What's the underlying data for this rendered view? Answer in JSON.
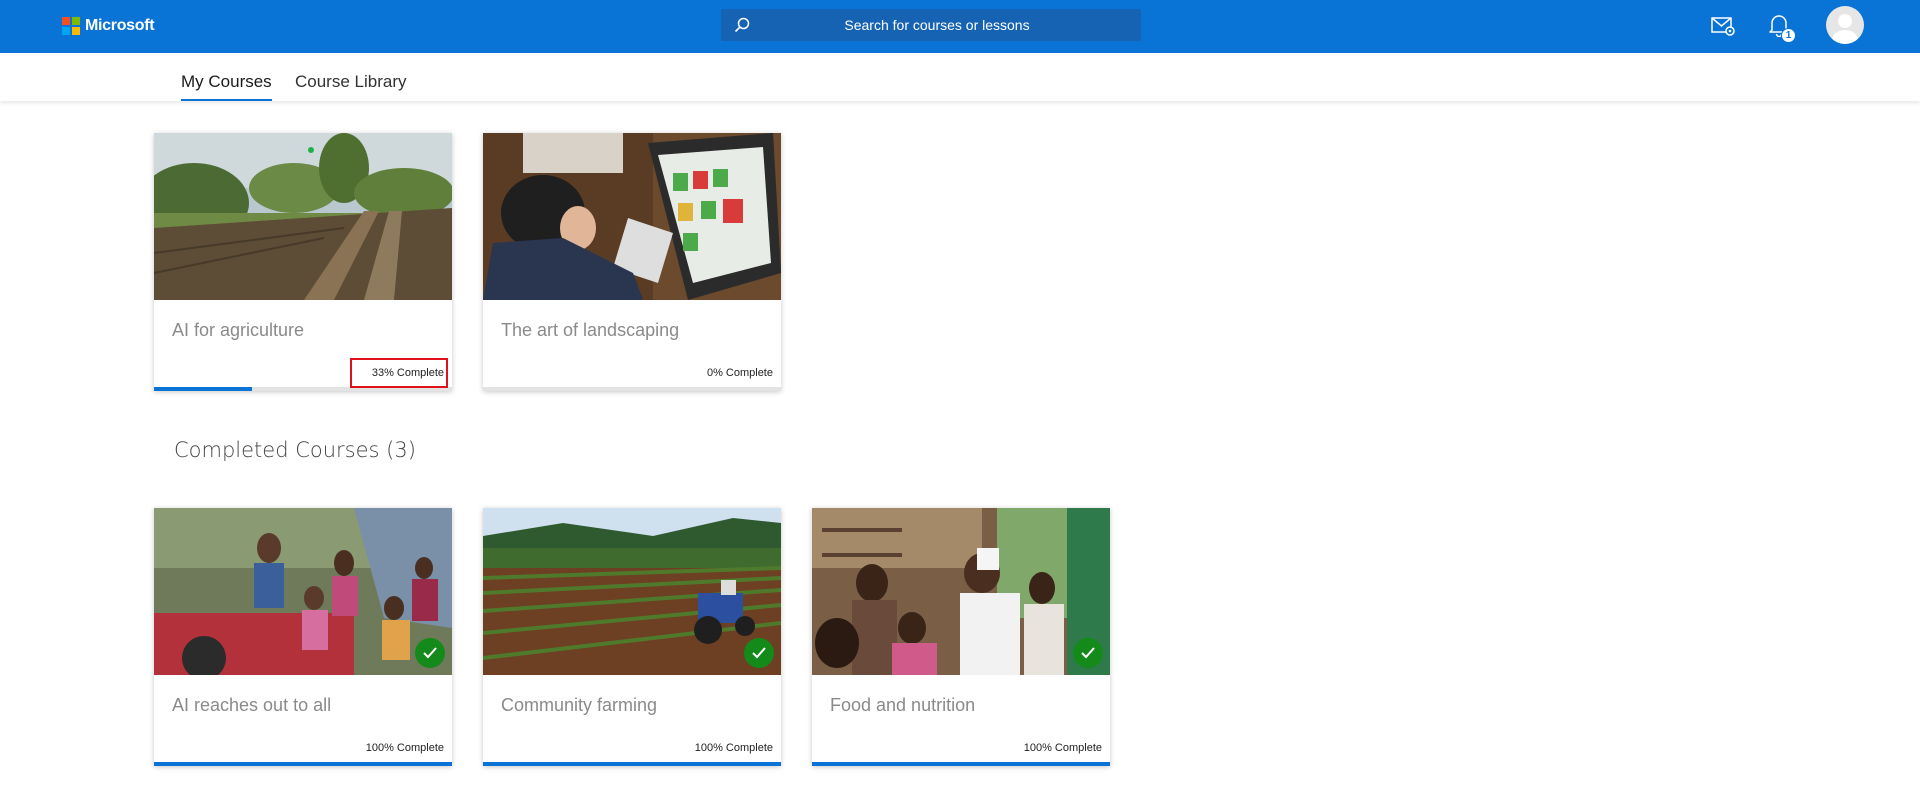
{
  "header": {
    "brand": "Microsoft",
    "brand_colors": [
      "#f25022",
      "#7fba00",
      "#00a4ef",
      "#ffb900"
    ],
    "search_placeholder": "Search for courses or lessons",
    "notification_count": "1",
    "accent": "#0a74d6"
  },
  "tabs": [
    {
      "label": "My Courses",
      "active": true
    },
    {
      "label": "Course Library",
      "active": false
    }
  ],
  "in_progress": [
    {
      "title": "AI for agriculture",
      "progress_label": "33% Complete",
      "progress": 0.33,
      "image": "farm-field-photo"
    },
    {
      "title": "The art of landscaping",
      "progress_label": "0% Complete",
      "progress": 0.0,
      "image": "tablet-design-photo"
    }
  ],
  "completed_heading": "Completed Courses (3)",
  "completed": [
    {
      "title": "AI reaches out to all",
      "progress_label": "100% Complete",
      "progress": 1.0,
      "image": "children-tractor-photo"
    },
    {
      "title": "Community farming",
      "progress_label": "100% Complete",
      "progress": 1.0,
      "image": "crop-rows-tractor-photo"
    },
    {
      "title": "Food and nutrition",
      "progress_label": "100% Complete",
      "progress": 1.0,
      "image": "family-gathering-photo"
    }
  ]
}
